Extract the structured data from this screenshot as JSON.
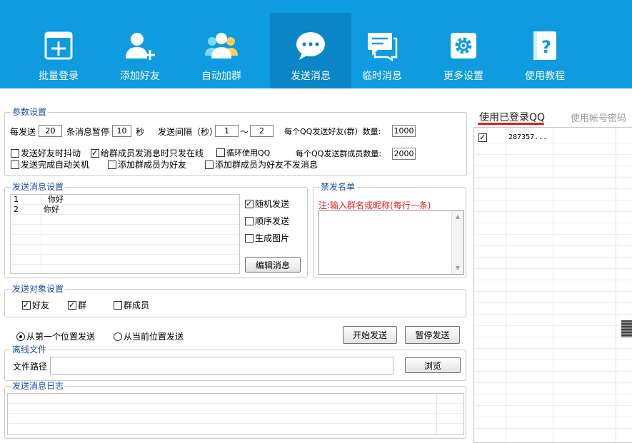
{
  "toolbar": {
    "items": [
      {
        "label": "批量登录",
        "icon": "batch-login-icon"
      },
      {
        "label": "添加好友",
        "icon": "add-friend-icon"
      },
      {
        "label": "自动加群",
        "icon": "auto-join-group-icon"
      },
      {
        "label": "发送消息",
        "icon": "send-message-icon",
        "active": true
      },
      {
        "label": "临时消息",
        "icon": "temp-message-icon"
      },
      {
        "label": "更多设置",
        "icon": "more-settings-icon"
      },
      {
        "label": "使用教程",
        "icon": "tutorial-icon"
      }
    ]
  },
  "params": {
    "title": "参数设置",
    "send_every": "每发送",
    "send_every_value": "20",
    "pause_label": "条消息暂停",
    "pause_value": "10",
    "seconds": "秒",
    "interval_label": "发送间隔（秒）",
    "interval_min": "1",
    "tilde": "～",
    "interval_max": "2",
    "friend_count_label": "每个QQ发送好友(群）数量:",
    "friend_count_value": "1000",
    "opt_shake": "发送好友时抖动",
    "opt_online_only": "给群成员发消息时只发在线",
    "opt_loop": "循环使用QQ",
    "member_count_label": "每个QQ发送群成员数量:",
    "member_count_value": "2000",
    "opt_shutdown": "发送完成自动关机",
    "opt_add_member": "添加群成员为好友",
    "opt_add_no_send": "添加群成员为好友不发消息"
  },
  "message": {
    "title": "发送消息设置",
    "rows": [
      {
        "no": "1",
        "text": "你好"
      },
      {
        "no": "2",
        "text": "你好"
      }
    ],
    "random_send": "随机发送",
    "sequential_send": "顺序发送",
    "generate_image": "生成图片",
    "edit_button": "编辑消息"
  },
  "blacklist": {
    "title": "禁发名单",
    "note": "注:输入群名或昵称(每行一条)"
  },
  "target": {
    "title": "发送对象设置",
    "friends": "好友",
    "groups": "群",
    "members": "群成员"
  },
  "position": {
    "from_first": "从第一个位置发送",
    "from_current": "从当前位置发送",
    "start_button": "开始发送",
    "pause_button": "暂停发送"
  },
  "offline": {
    "title": "离线文件",
    "path_label": "文件路径",
    "path_value": "",
    "browse_button": "浏览"
  },
  "log": {
    "title": "发送消息日志"
  },
  "accounts": {
    "tab_logged_in": "使用已登录QQ",
    "tab_password": "使用帐号密码",
    "rows": [
      {
        "checked": true,
        "account": "287357..."
      }
    ]
  },
  "colors": {
    "toolbar_bg": "#0e9be0",
    "toolbar_active": "#0a86c6",
    "group_title": "#1a4fa3",
    "note_red": "#e31b1b"
  }
}
